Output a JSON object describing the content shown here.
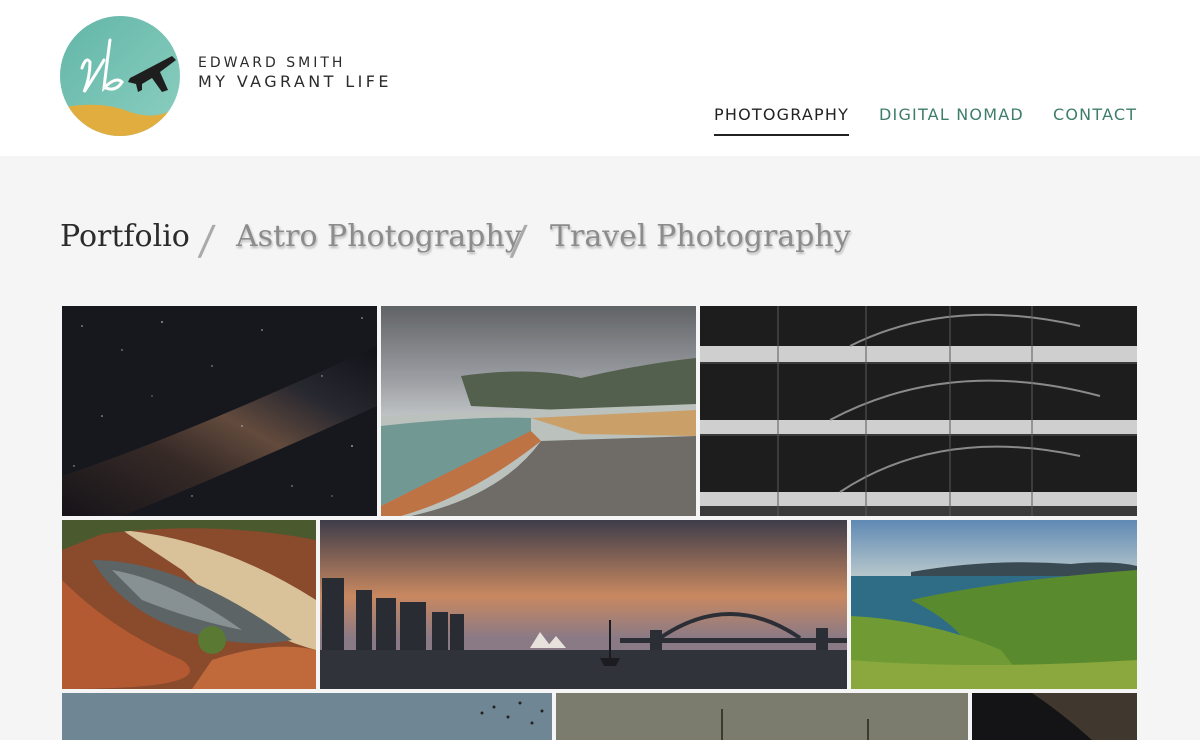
{
  "brand": {
    "name": "EDWARD SMITH",
    "tagline": "MY VAGRANT LIFE",
    "monogram": "vl",
    "colors": {
      "teal": "#6cc0b3",
      "sand": "#e1ad3e",
      "ink": "#222222"
    }
  },
  "nav": {
    "items": [
      {
        "label": "PHOTOGRAPHY",
        "active": true
      },
      {
        "label": "DIGITAL NOMAD",
        "active": false
      },
      {
        "label": "CONTACT",
        "active": false
      }
    ],
    "accent_color": "#3e7d6a"
  },
  "categories": {
    "items": [
      {
        "label": "Portfolio",
        "current": true
      },
      {
        "label": "Astro Photography",
        "current": false
      },
      {
        "label": "Travel Photography",
        "current": false
      }
    ],
    "separator": "/"
  },
  "gallery": {
    "photos": [
      {
        "subject": "milky-way-night-sky"
      },
      {
        "subject": "geothermal-hot-pool-steam"
      },
      {
        "subject": "bridge-reflection-in-building-windows"
      },
      {
        "subject": "rock-gorge-waterhole"
      },
      {
        "subject": "harbour-bridge-city-sunset"
      },
      {
        "subject": "green-coastal-hills"
      },
      {
        "subject": "dusk-sky-with-birds"
      },
      {
        "subject": "sailing-ship-masts"
      },
      {
        "subject": "night-sky"
      }
    ]
  }
}
